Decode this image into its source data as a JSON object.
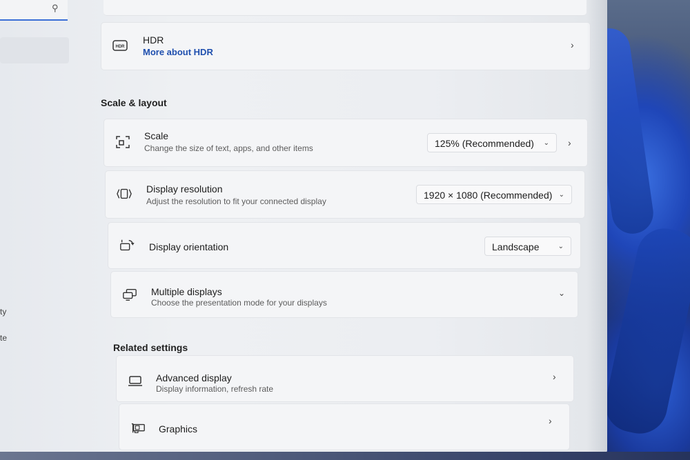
{
  "sidebar": {
    "nav_fragment_1": "ty",
    "nav_fragment_2": "te"
  },
  "hdr": {
    "title": "HDR",
    "link": "More about HDR"
  },
  "scale_layout": {
    "header": "Scale & layout",
    "scale": {
      "title": "Scale",
      "subtitle": "Change the size of text, apps, and other items",
      "value": "125% (Recommended)"
    },
    "resolution": {
      "title": "Display resolution",
      "subtitle": "Adjust the resolution to fit your connected display",
      "value": "1920 × 1080 (Recommended)"
    },
    "orientation": {
      "title": "Display orientation",
      "value": "Landscape"
    },
    "multiple": {
      "title": "Multiple displays",
      "subtitle": "Choose the presentation mode for your displays"
    }
  },
  "related": {
    "header": "Related settings",
    "advanced": {
      "title": "Advanced display",
      "subtitle": "Display information, refresh rate"
    },
    "graphics": {
      "title": "Graphics"
    }
  },
  "icons": {
    "search": "search-icon",
    "hdr": "hdr-icon",
    "scale": "scale-icon",
    "resolution": "resolution-icon",
    "orientation": "orientation-icon",
    "multiple": "multiple-displays-icon",
    "advanced": "monitor-icon",
    "graphics": "graphics-card-icon"
  },
  "colors": {
    "accent": "#3b6fd6",
    "link": "#1f4fae"
  }
}
